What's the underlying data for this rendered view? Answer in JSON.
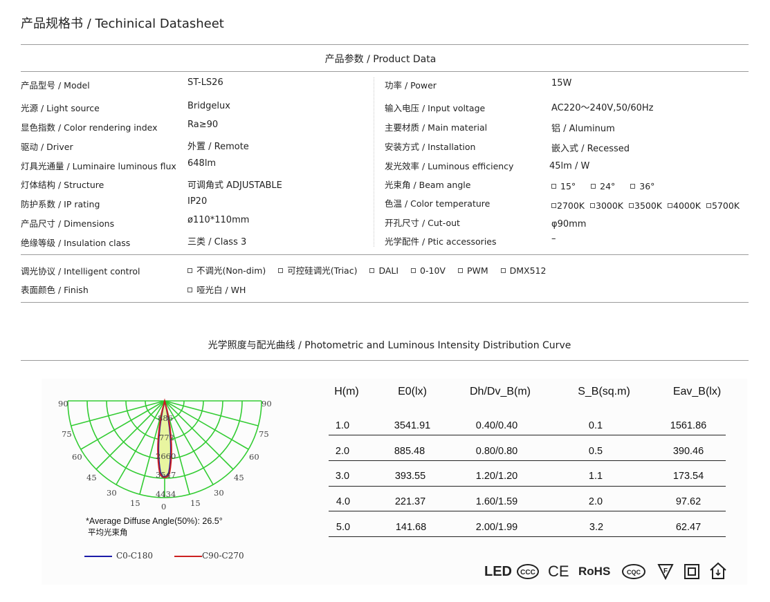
{
  "doc_title": "产品规格书 / Techinical Datasheet",
  "product_section_title": "产品参数 / Product Data",
  "specs_left": [
    {
      "label": "产品型号 / Model",
      "value": "ST-LS26"
    },
    {
      "label": "光源 / Light source",
      "value": "Bridgelux"
    },
    {
      "label": "显色指数 / Color rendering index",
      "value": "Ra≥90"
    },
    {
      "label": "驱动 / Driver",
      "value": "外置 / Remote"
    },
    {
      "label": "灯具光通量 / Luminaire luminous flux",
      "value": "648lm"
    },
    {
      "label": "灯体结构 / Structure",
      "value": "可调角式 ADJUSTABLE"
    },
    {
      "label": "防护系数 / IP rating",
      "value": "IP20"
    },
    {
      "label": "产品尺寸 / Dimensions",
      "value": "ø110*110mm"
    },
    {
      "label": "绝缘等级 / Insulation class",
      "value": "三类 / Class 3"
    }
  ],
  "specs_right": [
    {
      "label": "功率 / Power",
      "value": "15W"
    },
    {
      "label": "输入电压 / Input voltage",
      "value": "AC220～240V,50/60Hz"
    },
    {
      "label": "主要材质 / Main material",
      "value": "铝 / Aluminum"
    },
    {
      "label": "安装方式 / Installation",
      "value": "嵌入式 / Recessed"
    },
    {
      "label": "发光效率 / Luminous efficiency",
      "value": "45lm / W"
    },
    {
      "label": "光束角 / Beam angle",
      "options": [
        "15°",
        "24°",
        "36°"
      ]
    },
    {
      "label": "色温 / Color temperature",
      "options": [
        "2700K",
        "3000K",
        "3500K",
        "4000K",
        "5700K"
      ]
    },
    {
      "label": "开孔尺寸 / Cut-out",
      "value": "φ90mm"
    },
    {
      "label": "光学配件 / Ptic accessories",
      "value": "–"
    }
  ],
  "control": {
    "label": "调光协议 / Intelligent control",
    "options": [
      "不调光(Non-dim)",
      "可控硅调光(Triac)",
      "DALI",
      "0-10V",
      "PWM",
      "DMX512"
    ]
  },
  "finish": {
    "label": "表面颜色 / Finish",
    "options": [
      "哑光白 / WH"
    ]
  },
  "photometric_title": "光学照度与配光曲线 / Photometric and Luminous Intensity Distribution Curve",
  "polar": {
    "angle_labels": [
      "90",
      "75",
      "60",
      "45",
      "30",
      "15",
      "0"
    ],
    "ring_labels": [
      "886",
      "772",
      "2660",
      "3547",
      "4434"
    ],
    "series_colors": {
      "c0": "#1a1aa8",
      "c90": "#cc2020"
    }
  },
  "diffuse_note": "*Average Diffuse Angle(50%): 26.5°",
  "diffuse_note_cn": "平均光束角",
  "legend": [
    {
      "name": "C0-C180",
      "color": "#1a1aa8"
    },
    {
      "name": "C90-C270",
      "color": "#cc2020"
    }
  ],
  "table": {
    "headers": [
      "H(m)",
      "E0(lx)",
      "Dh/Dv_B(m)",
      "S_B(sq.m)",
      "Eav_B(lx)"
    ],
    "rows": [
      [
        "1.0",
        "3541.91",
        "0.40/0.40",
        "0.1",
        "1561.86"
      ],
      [
        "2.0",
        "885.48",
        "0.80/0.80",
        "0.5",
        "390.46"
      ],
      [
        "3.0",
        "393.55",
        "1.20/1.20",
        "1.1",
        "173.54"
      ],
      [
        "4.0",
        "221.37",
        "1.60/1.59",
        "2.0",
        "97.62"
      ],
      [
        "5.0",
        "141.68",
        "2.00/1.99",
        "3.2",
        "62.47"
      ]
    ]
  },
  "certifications": {
    "led": "LED",
    "ce": "CE",
    "rohs": "RoHS",
    "ccc": "CCC",
    "cqc": "CQC",
    "f_mark": "F"
  }
}
